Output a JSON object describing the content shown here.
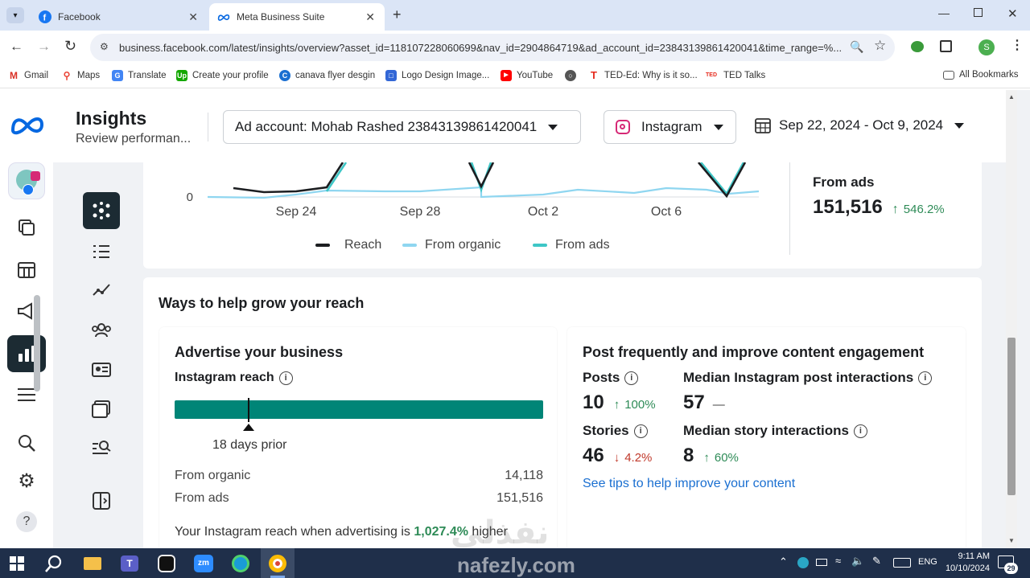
{
  "browser": {
    "tabs": [
      {
        "title": "Facebook",
        "active": false
      },
      {
        "title": "Meta Business Suite",
        "active": true
      }
    ],
    "url": "business.facebook.com/latest/insights/overview?asset_id=118107228060699&nav_id=2904864719&ad_account_id=23843139861420041&time_range=%...",
    "bookmarks": [
      "Gmail",
      "Maps",
      "Translate",
      "Create your profile",
      "canava flyer desgin",
      "Logo Design Image...",
      "YouTube",
      "TED-Ed: Why is it so...",
      "TED Talks"
    ],
    "all_bookmarks": "All Bookmarks",
    "profile_initial": "S"
  },
  "header": {
    "title": "Insights",
    "subtitle": "Review performan...",
    "ad_account": "Ad account: Mohab Rashed 23843139861420041",
    "platform": "Instagram",
    "date_range": "Sep 22, 2024 - Oct 9, 2024"
  },
  "chart_data": {
    "type": "line",
    "x_ticks": [
      "Sep 24",
      "Sep 28",
      "Oct 2",
      "Oct 6"
    ],
    "y_ticks": [
      "0"
    ],
    "series": [
      {
        "name": "Reach",
        "color": "#1c1e21"
      },
      {
        "name": "From organic",
        "color": "#8fd6f0"
      },
      {
        "name": "From ads",
        "color": "#3ec6c6"
      }
    ]
  },
  "from_ads_summary": {
    "label": "From ads",
    "value": "151,516",
    "change": "546.2%",
    "direction": "up"
  },
  "grow": {
    "title": "Ways to help grow your reach",
    "advertise": {
      "title": "Advertise your business",
      "reach_label": "Instagram reach",
      "marker_label": "18 days prior",
      "rows": [
        {
          "label": "From organic",
          "value": "14,118"
        },
        {
          "label": "From ads",
          "value": "151,516"
        }
      ],
      "footer_prefix": "Your Instagram reach when advertising is",
      "footer_highlight": "1,027.4%",
      "footer_suffix": "higher"
    },
    "post": {
      "title": "Post frequently and improve content engagement",
      "posts_label": "Posts",
      "posts_value": "10",
      "posts_change": "100%",
      "median_post_label": "Median Instagram post interactions",
      "median_post_value": "57",
      "median_post_change": "—",
      "stories_label": "Stories",
      "stories_value": "46",
      "stories_change": "4.2%",
      "median_story_label": "Median story interactions",
      "median_story_value": "8",
      "median_story_change": "60%",
      "tips_link": "See tips to help improve your content"
    }
  },
  "taskbar": {
    "time": "9:11 AM",
    "date": "10/10/2024",
    "lang": "ENG",
    "notifications": "29"
  },
  "watermark": {
    "arabic": "نفذلي",
    "latin": "nafezly.com"
  }
}
